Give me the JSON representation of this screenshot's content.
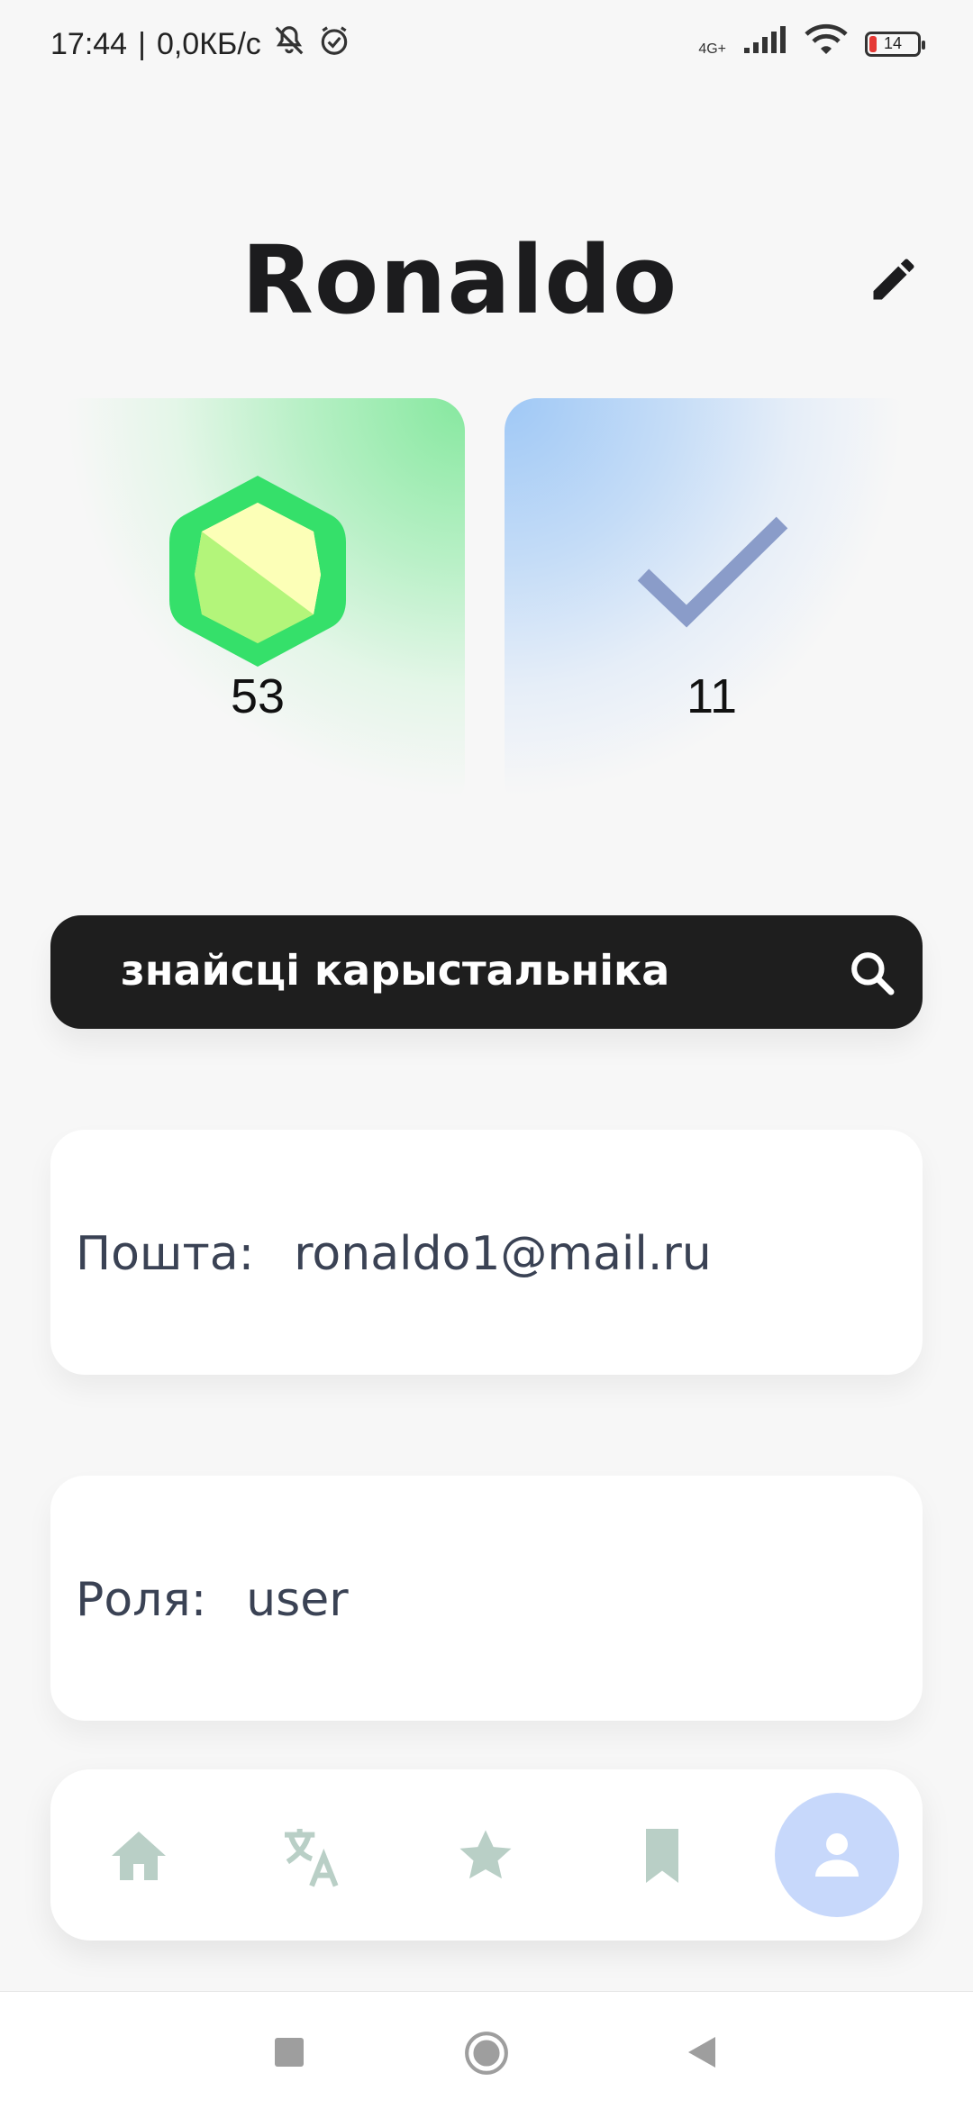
{
  "status_bar": {
    "time": "17:44",
    "separator": "|",
    "net_speed": "0,0КБ/с",
    "network_type": "4G+",
    "battery_level": "14",
    "icons": [
      "bell-off-icon",
      "alarm-icon",
      "signal-icon",
      "wifi-icon",
      "battery-icon"
    ]
  },
  "profile": {
    "name": "Ronaldo",
    "edit_icon": "pencil-icon"
  },
  "stats": {
    "gems": {
      "value": "53",
      "icon": "gem-icon"
    },
    "correct": {
      "value": "11",
      "icon": "check-icon"
    }
  },
  "search": {
    "label": "знайсці карыстальніка",
    "icon": "search-icon"
  },
  "info": {
    "email_label": "Пошта:",
    "email_value": "ronaldo1@mail.ru",
    "role_label": "Роля:",
    "role_value": "user"
  },
  "bottom_nav": {
    "items": [
      {
        "name": "home",
        "icon": "home-icon",
        "active": false
      },
      {
        "name": "translate",
        "icon": "translate-icon",
        "active": false
      },
      {
        "name": "favorites",
        "icon": "star-icon",
        "active": false
      },
      {
        "name": "bookmarks",
        "icon": "bookmark-icon",
        "active": false
      },
      {
        "name": "profile",
        "icon": "person-icon",
        "active": true
      }
    ]
  },
  "colors": {
    "background": "#f7f7f7",
    "search_bg": "#1e1e1e",
    "nav_icon_inactive": "#b9cfc6",
    "nav_active_bg": "#c7d8fb",
    "gem_green": "#35e06a",
    "check_color": "#8a9cc9"
  }
}
